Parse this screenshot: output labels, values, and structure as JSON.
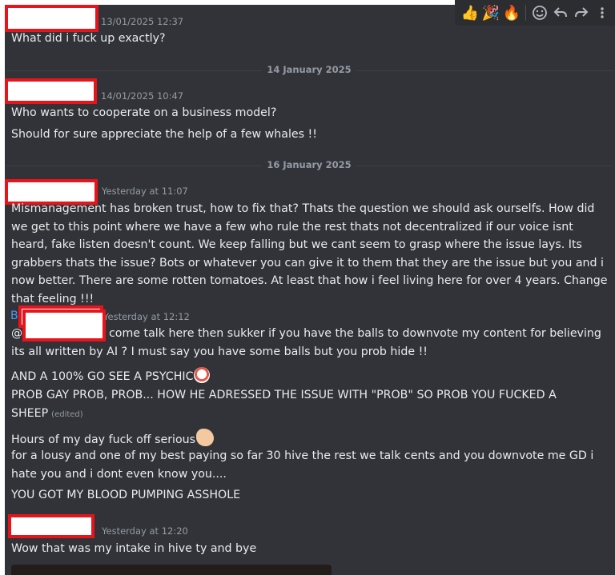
{
  "toolbar": {
    "reactions": [
      "thumbs-up",
      "party-popper",
      "fire"
    ],
    "actions": [
      "add-reaction",
      "reply",
      "forward",
      "more"
    ]
  },
  "messages": [
    {
      "timestamp": "13/01/2025 12:37",
      "lines": [
        "What did i fuck up exactly?"
      ]
    },
    {
      "timestamp": "14/01/2025 10:47",
      "lines": [
        "Who wants to cooperate on a business model?",
        "Should for sure appreciate the help of a few whales !!"
      ]
    },
    {
      "timestamp": "Yesterday at 11:07",
      "paragraph": "Mismanagement has broken trust, how to fix that? Thats the question we should ask ourselfs. How did we get to this point where we have a few who rule the rest thats not decentralized if our voice isnt heard, fake listen doesn't count. We keep falling but we cant seem to grasp where the issue lays. Its grabbers thats the issue? Bots or whatever you can give it to them that they are the issue but you and i now better. There are some rotten tomatoes. At least that how i feel living here for over 4 years. Change that feeling !!!"
    },
    {
      "author_initial": "B",
      "timestamp": "Yesterday at 12:12",
      "mention_prefix": "@",
      "line1_rest": "come talk here then sukker if you have the balls to downvote my content for believing",
      "line2": "its all written by AI ? I must say you have some balls but you prob hide  !!",
      "line3": "AND A 100% GO SEE A PSYCHIC",
      "line4a": "PROB GAY PROB, PROB... HOW HE ADRESSED THE ISSUE WITH \"PROB\" SO PROB YOU FUCKED A",
      "line4b": "SHEEP",
      "edited": "(edited)",
      "line5": "Hours of my day fuck off serious",
      "line6a": "for a lousy and one of my best paying so far 30 hive the rest we talk cents and you downvote me GD i",
      "line6b": "hate you and i dont even know you....",
      "line7": "YOU GOT MY BLOOD PUMPING ASSHOLE"
    },
    {
      "timestamp": "Yesterday at 12:20",
      "lines": [
        "Wow that was my intake in hive ty and bye"
      ]
    }
  ],
  "dividers": [
    "14 January 2025",
    "16 January 2025"
  ],
  "colors": {
    "background": "#313338",
    "redaction_border": "#e8141c",
    "author_link": "#5197ed"
  }
}
